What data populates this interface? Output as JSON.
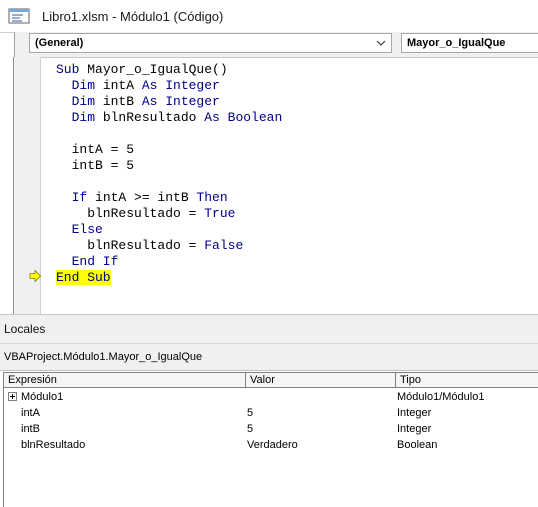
{
  "window": {
    "title": "Libro1.xlsm - Módulo1 (Código)",
    "icon": "vba-module-icon"
  },
  "code_pane": {
    "object_combo": "(General)",
    "procedure_combo": "Mayor_o_IgualQue",
    "lines": [
      [
        {
          "t": "Sub ",
          "k": true
        },
        {
          "t": "Mayor_o_IgualQue()",
          "k": false
        }
      ],
      [
        {
          "t": "  Dim ",
          "k": true
        },
        {
          "t": "intA ",
          "k": false
        },
        {
          "t": "As Integer",
          "k": true
        }
      ],
      [
        {
          "t": "  Dim ",
          "k": true
        },
        {
          "t": "intB ",
          "k": false
        },
        {
          "t": "As Integer",
          "k": true
        }
      ],
      [
        {
          "t": "  Dim ",
          "k": true
        },
        {
          "t": "blnResultado ",
          "k": false
        },
        {
          "t": "As Boolean",
          "k": true
        }
      ],
      [],
      [
        {
          "t": "  intA = 5",
          "k": false
        }
      ],
      [
        {
          "t": "  intB = 5",
          "k": false
        }
      ],
      [],
      [
        {
          "t": "  If ",
          "k": true
        },
        {
          "t": "intA >= intB ",
          "k": false
        },
        {
          "t": "Then",
          "k": true
        }
      ],
      [
        {
          "t": "    blnResultado = ",
          "k": false
        },
        {
          "t": "True",
          "k": true
        }
      ],
      [
        {
          "t": "  Else",
          "k": true
        }
      ],
      [
        {
          "t": "    blnResultado = ",
          "k": false
        },
        {
          "t": "False",
          "k": true
        }
      ],
      [
        {
          "t": "  End If",
          "k": true
        }
      ],
      [
        {
          "t": "End Sub",
          "k": true,
          "hl": true
        }
      ]
    ]
  },
  "locals": {
    "title": "Locales",
    "context": "VBAProject.Módulo1.Mayor_o_IgualQue",
    "columns": [
      "Expresión",
      "Valor",
      "Tipo"
    ],
    "rows": [
      {
        "expr": "Módulo1",
        "value": "",
        "type": "Módulo1/Módulo1",
        "expandable": true
      },
      {
        "expr": "intA",
        "value": "5",
        "type": "Integer",
        "expandable": false
      },
      {
        "expr": "intB",
        "value": "5",
        "type": "Integer",
        "expandable": false
      },
      {
        "expr": "blnResultado",
        "value": "Verdadero",
        "type": "Boolean",
        "expandable": false
      }
    ]
  },
  "colors": {
    "keyword": "#00008b",
    "highlight": "#ffff00",
    "exec_arrow": "#e8c400"
  }
}
